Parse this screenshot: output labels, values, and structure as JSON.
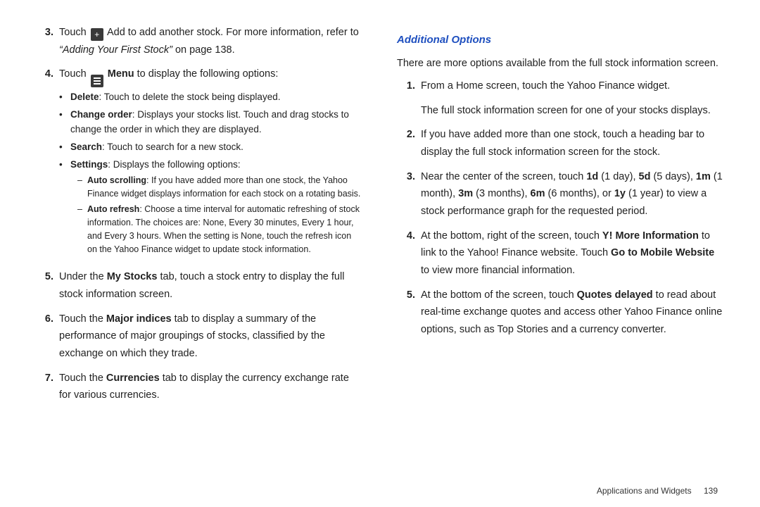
{
  "left": {
    "items": [
      {
        "num": "3.",
        "html": "Touch {PLUS} Add to add another stock. For more information, refer to <span class=\"ital\">“Adding Your First Stock”</span> on page 138."
      },
      {
        "num": "4.",
        "html": "Touch {MENU} <b>Menu</b> to display the following options:",
        "bullets": [
          {
            "html": "<b>Delete</b>: Touch to delete the stock being displayed."
          },
          {
            "html": "<b>Change order</b>: Displays your stocks list. Touch and drag stocks to change the order in which they are displayed."
          },
          {
            "html": "<b>Search</b>: Touch to search for a new stock."
          },
          {
            "html": "<b>Settings</b>: Displays the following options:",
            "dashes": [
              {
                "html": "<b>Auto scrolling</b>: If you have added more than one stock, the Yahoo Finance widget displays information for each stock on a rotating basis."
              },
              {
                "html": "<b>Auto refresh</b>: Choose a time interval for automatic refreshing of stock information. The choices are: None, Every 30 minutes, Every 1 hour, and Every 3 hours. When the setting is None, touch the refresh icon on the Yahoo Finance widget to update stock information."
              }
            ]
          }
        ]
      },
      {
        "num": "5.",
        "html": "Under the <b>My Stocks</b> tab, touch a stock entry to display the full stock information screen."
      },
      {
        "num": "6.",
        "html": "Touch the <b>Major indices</b> tab to display a summary of the performance of major groupings of stocks, classified by the exchange on which they trade."
      },
      {
        "num": "7.",
        "html": "Touch the <b>Currencies</b> tab to display the currency exchange rate for various currencies."
      }
    ]
  },
  "right": {
    "heading": "Additional Options",
    "intro": "There are more options available from the full stock information screen.",
    "items": [
      {
        "num": "1.",
        "html": "From a Home screen, touch the Yahoo Finance widget.<br><div style=\"height:10px\"></div>The full stock information screen for one of your stocks displays."
      },
      {
        "num": "2.",
        "html": "If you have added more than one stock, touch a heading bar to display the full stock information screen for the stock."
      },
      {
        "num": "3.",
        "html": "Near the center of the screen, touch <b>1d</b> (1 day), <b>5d</b> (5 days), <b>1m</b> (1 month), <b>3m</b> (3 months), <b>6m</b> (6 months), or <b>1y</b> (1 year) to view a stock performance graph for the requested period."
      },
      {
        "num": "4.",
        "html": "At the bottom, right of the screen, touch <b>Y! More Information</b> to link to the Yahoo! Finance website. Touch <b>Go to Mobile Website</b> to view more financial information."
      },
      {
        "num": "5.",
        "html": "At the bottom of the screen, touch <b>Quotes delayed</b> to read about real-time exchange quotes and access other Yahoo Finance online options, such as Top Stories and a currency converter."
      }
    ]
  },
  "footer": {
    "section": "Applications and Widgets",
    "page": "139"
  },
  "icons": {
    "plus": "<span class=\"icon\" data-name=\"plus-icon\" data-interactable=\"false\">+</span>",
    "menu": "<span class=\"icon icon-menu\" data-name=\"menu-icon\" data-interactable=\"false\"><span></span><span></span><span></span></span>"
  }
}
